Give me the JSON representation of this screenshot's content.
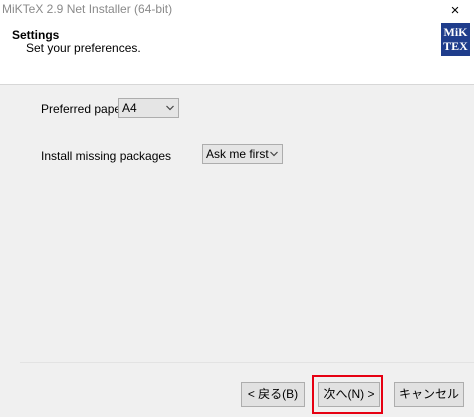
{
  "window": {
    "title": "MiKTeX 2.9 Net Installer (64-bit)",
    "close_glyph": "×"
  },
  "header": {
    "title": "Settings",
    "subtitle": "Set your preferences.",
    "logo_line1": "MiK",
    "logo_line2": "TEX"
  },
  "settings": {
    "paper_label": "Preferred paper:",
    "paper_value": "A4",
    "missing_label": "Install missing packages",
    "missing_value": "Ask me first"
  },
  "buttons": {
    "back": "< 戻る(B)",
    "next": "次へ(N) >",
    "cancel": "キャンセル"
  },
  "colors": {
    "logo_bg": "#1f3d8c",
    "highlight": "#e60012"
  },
  "icons": {
    "close": "close-icon",
    "dropdown": "chevron-down-icon"
  }
}
